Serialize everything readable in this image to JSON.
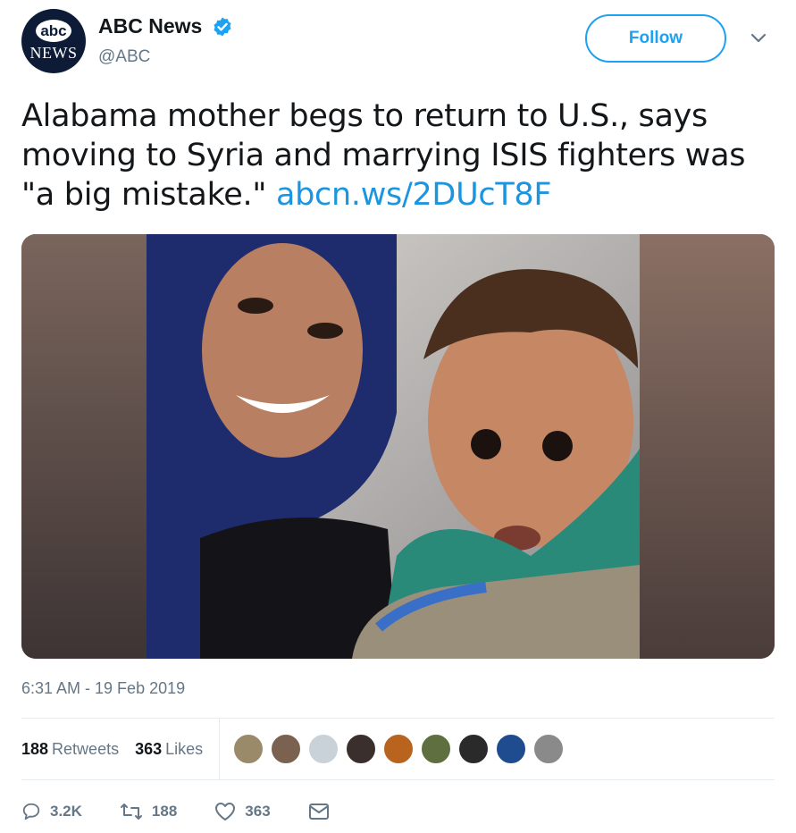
{
  "account": {
    "display_name": "ABC News",
    "handle": "@ABC",
    "avatar_top": "abc",
    "avatar_bottom": "NEWS",
    "verified": true
  },
  "follow_label": "Follow",
  "tweet": {
    "text": "Alabama mother begs to return to U.S., says moving to Syria and marrying ISIS fighters was \"a big mistake.\" ",
    "link": "abcn.ws/2DUcT8F"
  },
  "media": {
    "type": "photo",
    "icon": "photo-woman-and-child"
  },
  "timestamp": "6:31 AM - 19 Feb 2019",
  "stats": {
    "retweets_count": "188",
    "retweets_label": "Retweets",
    "likes_count": "363",
    "likes_label": "Likes"
  },
  "likers": [
    "#9b8a6a",
    "#7a6150",
    "#c9d1d9",
    "#3a2f2c",
    "#b8641f",
    "#5f6f3f",
    "#2a2a2a",
    "#1f4b8f",
    "#8a8a8a"
  ],
  "actions": {
    "reply_count": "3.2K",
    "retweet_count": "188",
    "like_count": "363"
  },
  "colors": {
    "accent": "#1da1f2",
    "link": "#1b95e0",
    "muted": "#657786"
  }
}
